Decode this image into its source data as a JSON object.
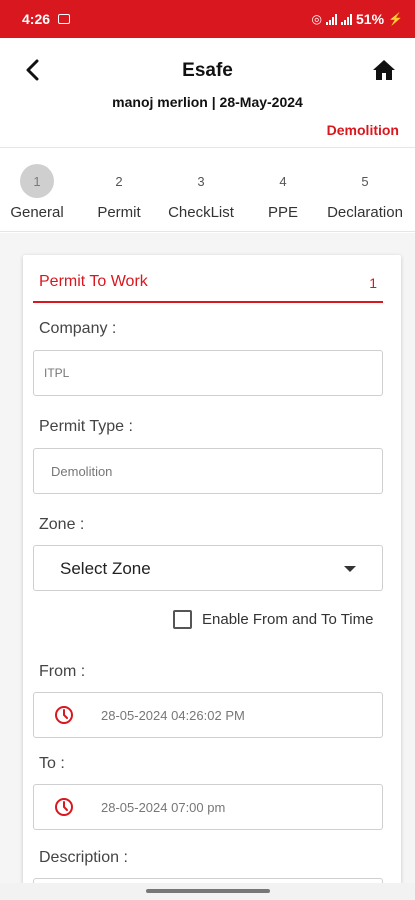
{
  "status_bar": {
    "time": "4:26",
    "battery": "51%"
  },
  "header": {
    "title": "Esafe",
    "subtitle": "manoj merlion | 28-May-2024",
    "permit_type_tag": "Demolition"
  },
  "steps": [
    {
      "number": "1",
      "label": "General",
      "active": true
    },
    {
      "number": "2",
      "label": "Permit"
    },
    {
      "number": "3",
      "label": "CheckList"
    },
    {
      "number": "4",
      "label": "PPE"
    },
    {
      "number": "5",
      "label": "Declaration"
    }
  ],
  "form": {
    "section_title": "Permit To Work",
    "section_count": "1",
    "company_label": "Company :",
    "company_value": "ITPL",
    "permit_type_label": "Permit Type :",
    "permit_type_value": "Demolition",
    "zone_label": "Zone :",
    "zone_value": "Select Zone",
    "enable_time_label": "Enable From and To Time",
    "from_label": "From :",
    "from_value": "28-05-2024 04:26:02 PM",
    "to_label": "To :",
    "to_value": "28-05-2024 07:00 pm",
    "description_label": "Description :"
  },
  "colors": {
    "accent": "#d9171e"
  }
}
